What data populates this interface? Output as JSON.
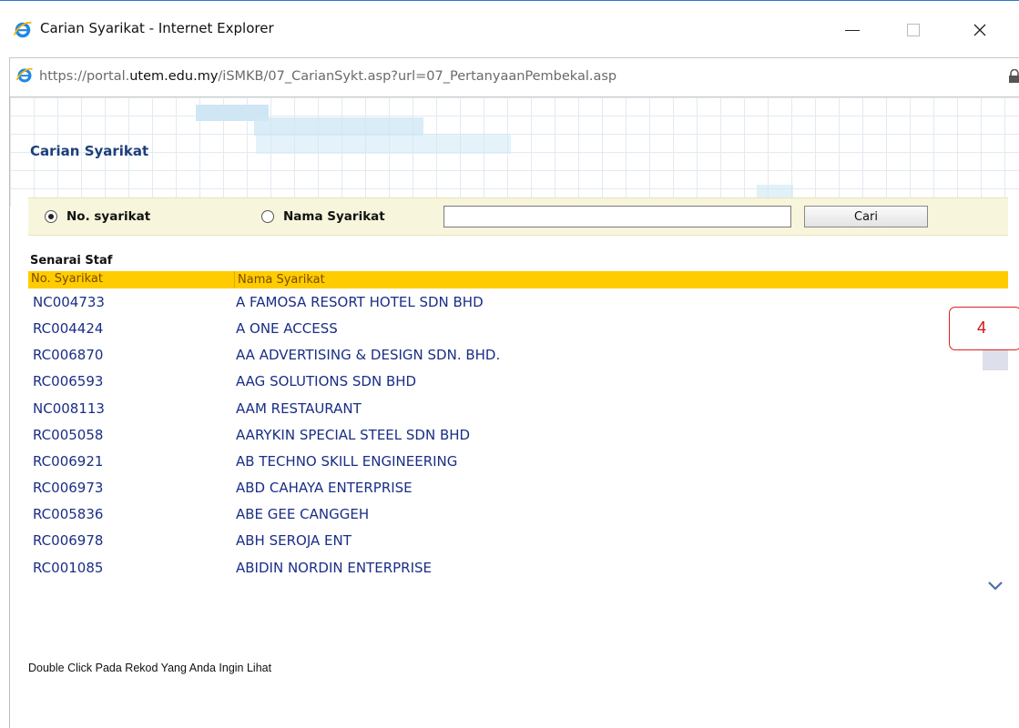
{
  "window": {
    "title": "Carian Syarikat - Internet Explorer",
    "minimize_label": "—",
    "close_label": "✕"
  },
  "address": {
    "url_prefix": "https://portal.",
    "url_domain": "utem.edu.my",
    "url_path": "/iSMKB/07_CarianSykt.asp?url=07_PertanyaanPembekal.asp"
  },
  "page": {
    "title": "Carian Syarikat",
    "search": {
      "option_no_label": "No. syarikat",
      "option_name_label": "Nama Syarikat",
      "selected_option": "No. syarikat",
      "input_value": "",
      "button_label": "Cari"
    },
    "list": {
      "title": "Senarai Staf",
      "columns": [
        "No. Syarikat",
        "Nama Syarikat"
      ],
      "rows": [
        {
          "no": "NC004733",
          "name": "A FAMOSA RESORT HOTEL SDN BHD"
        },
        {
          "no": "RC004424",
          "name": "A ONE ACCESS"
        },
        {
          "no": "RC006870",
          "name": "AA ADVERTISING & DESIGN SDN. BHD."
        },
        {
          "no": "RC006593",
          "name": "AAG SOLUTIONS SDN BHD"
        },
        {
          "no": "NC008113",
          "name": "AAM RESTAURANT"
        },
        {
          "no": "RC005058",
          "name": "AARYKIN SPECIAL STEEL SDN BHD"
        },
        {
          "no": "RC006921",
          "name": "AB TECHNO SKILL ENGINEERING"
        },
        {
          "no": "RC006973",
          "name": "ABD CAHAYA ENTERPRISE"
        },
        {
          "no": "RC005836",
          "name": "ABE GEE CANGGEH"
        },
        {
          "no": "RC006978",
          "name": "ABH SEROJA ENT"
        },
        {
          "no": "RC001085",
          "name": "ABIDIN NORDIN ENTERPRISE"
        }
      ]
    },
    "page_indicator": "4",
    "footer_note": "Double Click Pada Rekod Yang Anda Ingin Lihat"
  },
  "colors": {
    "link_text": "#1a2e86",
    "header_bar": "#ffcc00",
    "search_panel": "#f7f6dc",
    "title_text": "#1f3f7a",
    "badge_border": "#e02020"
  }
}
